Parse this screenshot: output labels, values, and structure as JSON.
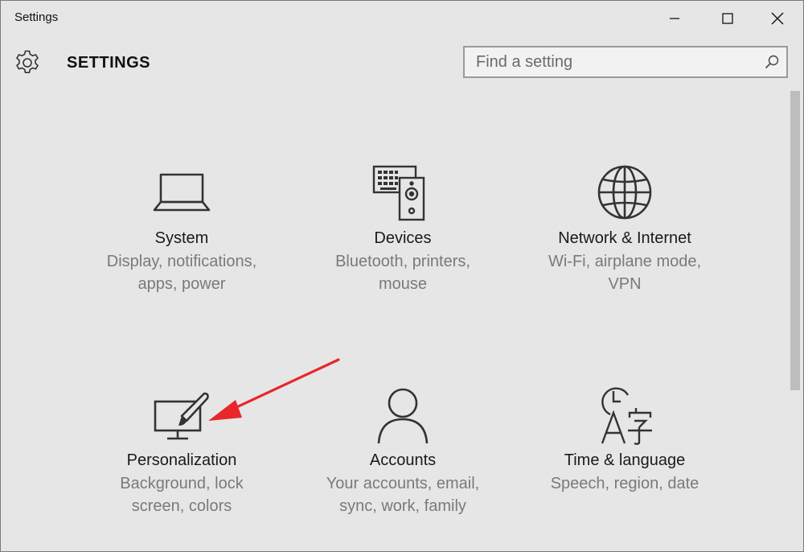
{
  "window": {
    "title": "Settings"
  },
  "header": {
    "page_title": "SETTINGS",
    "search_placeholder": "Find a setting"
  },
  "tiles": [
    {
      "title": "System",
      "desc": "Display, notifications,\napps, power",
      "icon": "laptop-icon"
    },
    {
      "title": "Devices",
      "desc": "Bluetooth, printers,\nmouse",
      "icon": "keyboard-speaker-icon"
    },
    {
      "title": "Network & Internet",
      "desc": "Wi-Fi, airplane mode,\nVPN",
      "icon": "globe-icon"
    },
    {
      "title": "Personalization",
      "desc": "Background, lock\nscreen, colors",
      "icon": "monitor-brush-icon"
    },
    {
      "title": "Accounts",
      "desc": "Your accounts, email,\nsync, work, family",
      "icon": "person-icon"
    },
    {
      "title": "Time & language",
      "desc": "Speech, region, date",
      "icon": "clock-language-icon"
    }
  ],
  "colors": {
    "background": "#e6e6e6",
    "annotation_arrow": "#e8262b"
  }
}
